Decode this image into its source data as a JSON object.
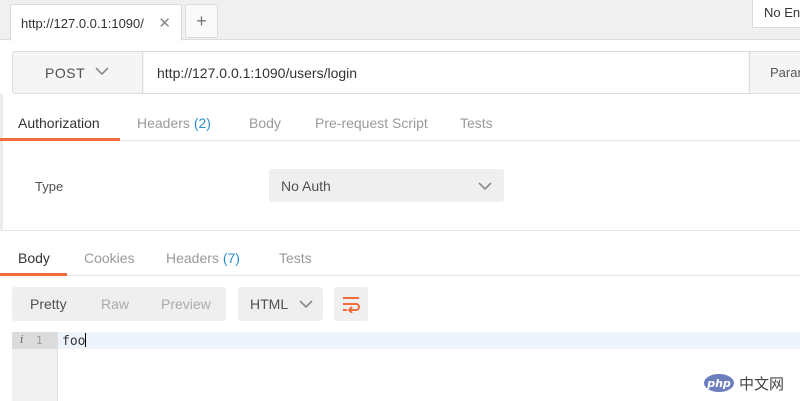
{
  "tab_bar": {
    "request_tab_label": "http://127.0.0.1:1090/",
    "close_symbol": "✕",
    "new_tab_symbol": "+",
    "environment_label": "No Environment"
  },
  "request": {
    "method": "POST",
    "url": "http://127.0.0.1:1090/users/login",
    "params_label": "Params"
  },
  "request_tabs": [
    {
      "label": "Authorization",
      "count": ""
    },
    {
      "label": "Headers",
      "count": "(2)"
    },
    {
      "label": "Body",
      "count": ""
    },
    {
      "label": "Pre-request Script",
      "count": ""
    },
    {
      "label": "Tests",
      "count": ""
    }
  ],
  "auth": {
    "type_label": "Type",
    "selected_type": "No Auth"
  },
  "response_tabs": [
    {
      "label": "Body",
      "count": ""
    },
    {
      "label": "Cookies",
      "count": ""
    },
    {
      "label": "Headers",
      "count": "(7)"
    },
    {
      "label": "Tests",
      "count": ""
    }
  ],
  "response_toolbar": {
    "view_modes": [
      "Pretty",
      "Raw",
      "Preview"
    ],
    "active_view": "Pretty",
    "language": "HTML",
    "wrap_icon": "wrap-lines-icon"
  },
  "editor": {
    "info_marker": "i",
    "line_number": "1",
    "content": "foo"
  },
  "watermark": {
    "logo_text": "php",
    "site_text": "中文网"
  },
  "colors": {
    "accent": "#f26b3a",
    "count": "#2f8fd0"
  }
}
